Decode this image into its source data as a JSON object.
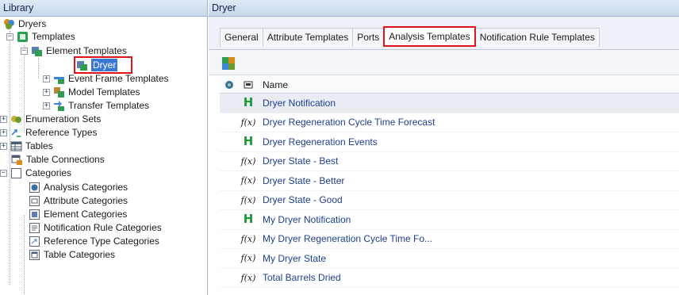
{
  "library": {
    "title": "Library",
    "tree": {
      "root": "Dryers",
      "templates": "Templates",
      "element_templates": "Element Templates",
      "dryer": "Dryer",
      "event_frame_templates": "Event Frame Templates",
      "model_templates": "Model Templates",
      "transfer_templates": "Transfer Templates",
      "enumeration_sets": "Enumeration Sets",
      "reference_types": "Reference Types",
      "tables": "Tables",
      "table_connections": "Table Connections",
      "categories": "Categories",
      "analysis_categories": "Analysis Categories",
      "attribute_categories": "Attribute Categories",
      "element_categories": "Element Categories",
      "notification_rule_categories": "Notification Rule Categories",
      "reference_type_categories": "Reference Type Categories",
      "table_categories": "Table Categories"
    }
  },
  "detail": {
    "title": "Dryer",
    "tabs": [
      "General",
      "Attribute Templates",
      "Ports",
      "Analysis Templates",
      "Notification Rule Templates"
    ],
    "active_tab": "Analysis Templates",
    "grid": {
      "columns": {
        "name": "Name"
      },
      "rows": [
        {
          "name": "Dryer Notification",
          "type": "notification"
        },
        {
          "name": "Dryer Regeneration Cycle Time Forecast",
          "type": "expression"
        },
        {
          "name": "Dryer Regeneration Events",
          "type": "notification"
        },
        {
          "name": "Dryer State - Best",
          "type": "expression"
        },
        {
          "name": "Dryer State - Better",
          "type": "expression"
        },
        {
          "name": "Dryer State - Good",
          "type": "expression"
        },
        {
          "name": "My Dryer Notification",
          "type": "notification"
        },
        {
          "name": "My Dryer Regeneration Cycle Time Fo...",
          "type": "expression"
        },
        {
          "name": "My Dryer State",
          "type": "expression"
        },
        {
          "name": "Total Barrels Dried",
          "type": "expression"
        }
      ],
      "expression_glyph": "f(x)",
      "notification_glyph": "H"
    }
  },
  "colors": {
    "header_bg": "#c9d8ed",
    "selection": "#3a78d4",
    "highlight_box": "#e0121b",
    "row_text": "#1f3f8a",
    "notification_icon": "#1c9a3a"
  }
}
